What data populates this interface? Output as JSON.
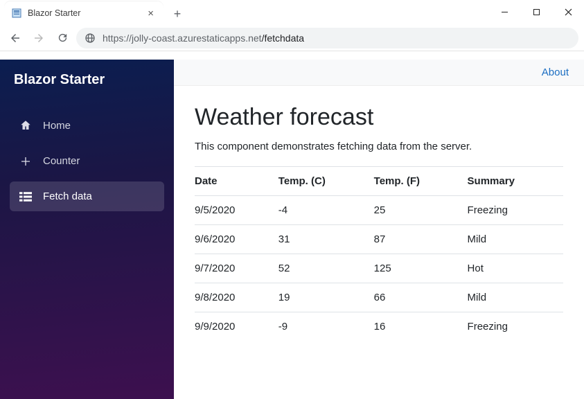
{
  "browser": {
    "tab_title": "Blazor Starter",
    "url_host": "https://jolly-coast.azurestaticapps.net",
    "url_path": "/fetchdata"
  },
  "sidebar": {
    "brand": "Blazor Starter",
    "items": [
      {
        "label": "Home",
        "icon": "home-icon",
        "active": false
      },
      {
        "label": "Counter",
        "icon": "plus-icon",
        "active": false
      },
      {
        "label": "Fetch data",
        "icon": "list-icon",
        "active": true
      }
    ]
  },
  "topbar": {
    "about_label": "About"
  },
  "page": {
    "title": "Weather forecast",
    "description": "This component demonstrates fetching data from the server."
  },
  "table": {
    "headers": [
      "Date",
      "Temp. (C)",
      "Temp. (F)",
      "Summary"
    ],
    "rows": [
      {
        "date": "9/5/2020",
        "tc": "-4",
        "tf": "25",
        "summary": "Freezing"
      },
      {
        "date": "9/6/2020",
        "tc": "31",
        "tf": "87",
        "summary": "Mild"
      },
      {
        "date": "9/7/2020",
        "tc": "52",
        "tf": "125",
        "summary": "Hot"
      },
      {
        "date": "9/8/2020",
        "tc": "19",
        "tf": "66",
        "summary": "Mild"
      },
      {
        "date": "9/9/2020",
        "tc": "-9",
        "tf": "16",
        "summary": "Freezing"
      }
    ]
  }
}
